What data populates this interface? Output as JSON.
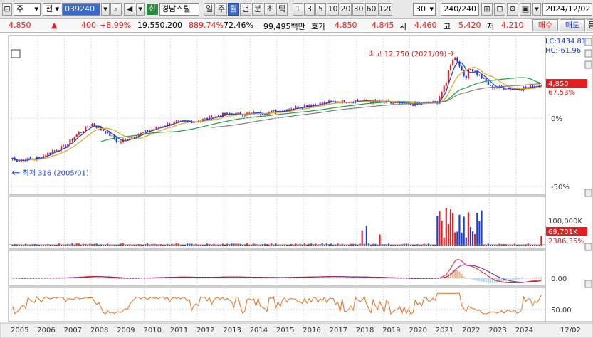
{
  "toolbar": {
    "market_type": "주",
    "period_prefix": "전",
    "code": "039240",
    "stock_badge": "신",
    "stock_name": "경남스틸",
    "period_tabs": [
      "일",
      "주",
      "월",
      "년",
      "분",
      "초",
      "틱"
    ],
    "active_period": "월",
    "count_buttons": [
      "1",
      "3",
      "5",
      "10",
      "20",
      "30",
      "60",
      "120"
    ],
    "interval_select": "30",
    "view_count": "240/240",
    "date": "2024/12/02"
  },
  "quote": {
    "price": "4,850",
    "arrow": "▲",
    "change": "400",
    "change_pct": "+8.99%",
    "volume": "19,550,200",
    "volume_ratio": "889.74%",
    "turnover_pct": "72.46%",
    "amount": "99,495백만",
    "ask_label": "호가",
    "ask": "4,850",
    "bid": "4,845",
    "open_label": "시",
    "open": "4,460",
    "high_label": "고",
    "high": "5,420",
    "low_label": "저",
    "low": "4,210",
    "buy_label": "매수",
    "sell_label": "매도",
    "more_label": "등"
  },
  "annotations": {
    "max_label": "최고 12,750 (2021/09)",
    "min_label": "최저 316 (2005/01)"
  },
  "right_axis": {
    "lc_label": "LC:1434.81",
    "hc_label": "HC:-61.96",
    "price_tag": "4,850",
    "price_pct": "67.53%",
    "ticks": [
      "0%",
      "-50%"
    ],
    "vol_tick": "100,000K",
    "vol_tag": "69,701K",
    "vol_pct": "2386.35%",
    "macd_tick": "0.00",
    "stoch_tick": "50.00"
  },
  "x_axis": [
    "2005",
    "2006",
    "2007",
    "2008",
    "2009",
    "2010",
    "2011",
    "2012",
    "2013",
    "2014",
    "2015",
    "2016",
    "2017",
    "2018",
    "2019",
    "2020",
    "2021",
    "2022",
    "2023",
    "2024",
    "12/02"
  ],
  "colors": {
    "up": "#e02020",
    "down": "#1a3fd8",
    "ma5": "#e8a020",
    "ma20": "#20a040",
    "ma60": "#808080",
    "ma_short": "#1a3fd8",
    "macd": "#e03030",
    "signal": "#7a2a8a",
    "osc": "#f0b080",
    "stoch": "#e07020"
  },
  "chart_data": {
    "type": "candlestick",
    "period": "monthly",
    "x_range": [
      "2005/01",
      "2024/12"
    ],
    "max": {
      "value": 12750,
      "date": "2021/09"
    },
    "min": {
      "value": 316,
      "date": "2005/01"
    },
    "last": {
      "close": 4850,
      "change": 400,
      "change_pct": 8.99,
      "open": 4460,
      "high": 5420,
      "low": 4210,
      "volume": 19550200
    },
    "yearly_closes": [
      {
        "x": "2005",
        "y": 420
      },
      {
        "x": "2006",
        "y": 620
      },
      {
        "x": "2007",
        "y": 1300
      },
      {
        "x": "2008",
        "y": 700
      },
      {
        "x": "2009",
        "y": 1000
      },
      {
        "x": "2010",
        "y": 1350
      },
      {
        "x": "2011",
        "y": 1450
      },
      {
        "x": "2012",
        "y": 1800
      },
      {
        "x": "2013",
        "y": 1850
      },
      {
        "x": "2014",
        "y": 2000
      },
      {
        "x": "2015",
        "y": 2400
      },
      {
        "x": "2016",
        "y": 2700
      },
      {
        "x": "2017",
        "y": 2850
      },
      {
        "x": "2018",
        "y": 2700
      },
      {
        "x": "2019",
        "y": 2500
      },
      {
        "x": "2020",
        "y": 2700
      },
      {
        "x": "2021",
        "y": 9500
      },
      {
        "x": "2022",
        "y": 4500
      },
      {
        "x": "2023",
        "y": 4200
      },
      {
        "x": "2024",
        "y": 4850
      }
    ]
  }
}
